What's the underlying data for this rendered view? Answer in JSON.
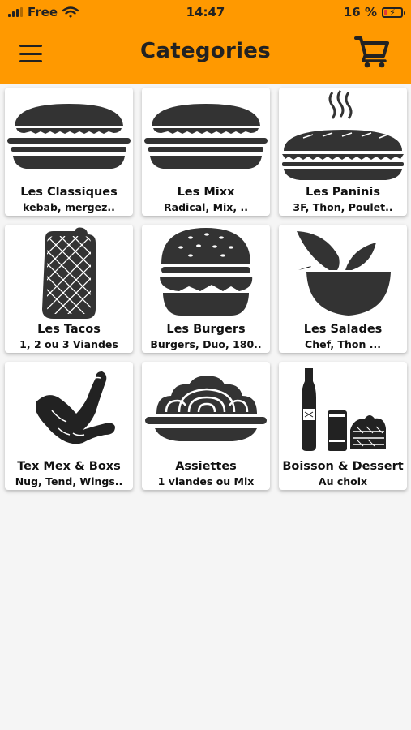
{
  "status": {
    "carrier": "Free",
    "time": "14:47",
    "battery": "16 %"
  },
  "header": {
    "title": "Categories",
    "menu_icon": "hamburger-menu-icon",
    "cart_icon": "shopping-cart-icon"
  },
  "categories": [
    {
      "name": "Les Classiques",
      "desc": "kebab, mergez..",
      "icon": "sandwich-icon"
    },
    {
      "name": "Les Mixx",
      "desc": "Radical, Mix, ..",
      "icon": "sandwich-icon"
    },
    {
      "name": "Les Paninis",
      "desc": "3F, Thon, Poulet..",
      "icon": "panini-icon"
    },
    {
      "name": "Les Tacos",
      "desc": "1, 2 ou 3 Viandes",
      "icon": "tacos-icon"
    },
    {
      "name": "Les Burgers",
      "desc": "Burgers, Duo, 180..",
      "icon": "burger-icon"
    },
    {
      "name": "Les Salades",
      "desc": "Chef, Thon ...",
      "icon": "salad-bowl-icon"
    },
    {
      "name": "Tex Mex & Boxs",
      "desc": "Nug, Tend, Wings..",
      "icon": "chicken-wings-icon"
    },
    {
      "name": "Assiettes",
      "desc": "1 viandes ou Mix",
      "icon": "plate-icon"
    },
    {
      "name": "Boisson & Dessert",
      "desc": "Au choix",
      "icon": "drink-dessert-icon"
    }
  ]
}
